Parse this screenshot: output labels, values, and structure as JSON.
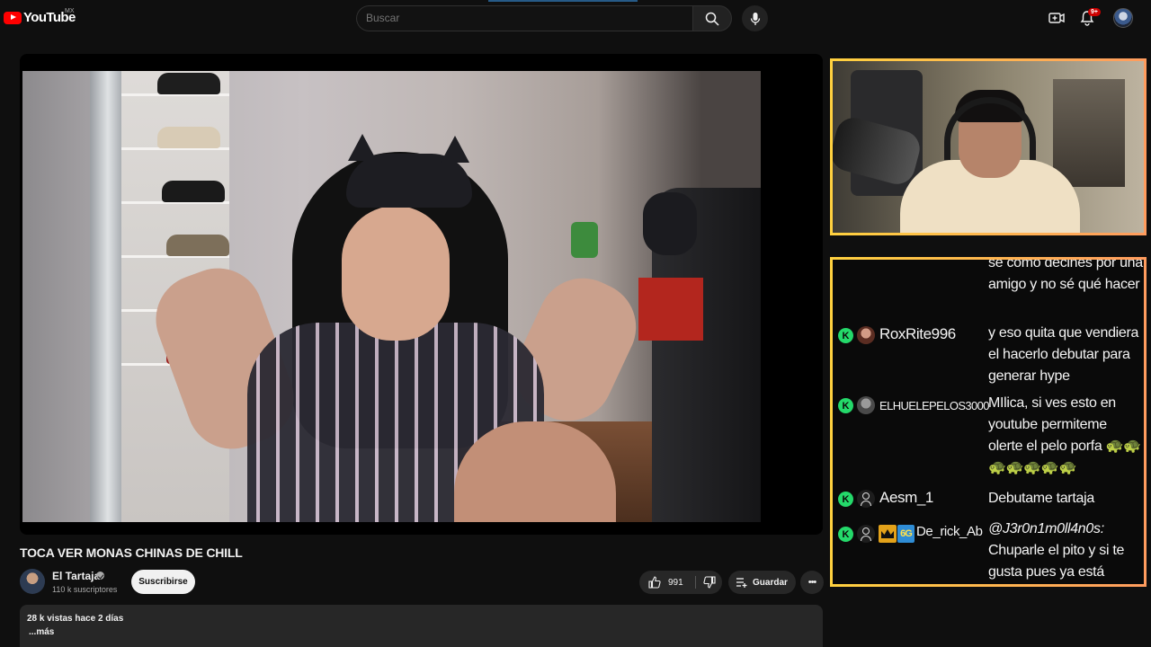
{
  "header": {
    "logo_text": "YouTube",
    "country": "MX",
    "search_placeholder": "Buscar",
    "notification_count": "9+"
  },
  "video": {
    "title": "TOCA VER MONAS CHINAS DE CHILL",
    "channel_name": "El Tartaja",
    "subscribers": "110 k suscriptores",
    "subscribe_label": "Suscribirse",
    "likes": "991",
    "save_label": "Guardar",
    "more_label": "•••",
    "views_date": "28 k vistas  hace 2 días",
    "desc_more": "...más"
  },
  "chat": {
    "messages": [
      {
        "user": "",
        "text": "se como decines por una amigo y no sé qué hacer"
      },
      {
        "user": "RoxRite996",
        "text": "y eso quita que vendiera el hacerlo debutar para generar hype"
      },
      {
        "user": "ELHUELEPELOS3000",
        "text": "MIlica, si ves esto en youtube permiteme olerte el pelo porfa 🐢🐢 🐢🐢🐢🐢🐢"
      },
      {
        "user": "Aesm_1",
        "text": "Debutame tartaja"
      },
      {
        "user": "De_rick_Ab",
        "mention": "@J3r0n1m0ll4n0s:",
        "text": "Chuparle el pito y si te gusta pues ya está",
        "badge": "6G"
      }
    ]
  },
  "colors": {
    "accent_border_start": "#ffd13f",
    "accent_border_end": "#ff9c5e",
    "kick_green": "#24d96a",
    "youtube_red": "#ff0000"
  },
  "icons": [
    "search-icon",
    "mic-icon",
    "create-icon",
    "bell-icon",
    "like-icon",
    "dislike-icon",
    "save-playlist-icon",
    "verified-icon",
    "kick-icon",
    "crown-icon"
  ]
}
